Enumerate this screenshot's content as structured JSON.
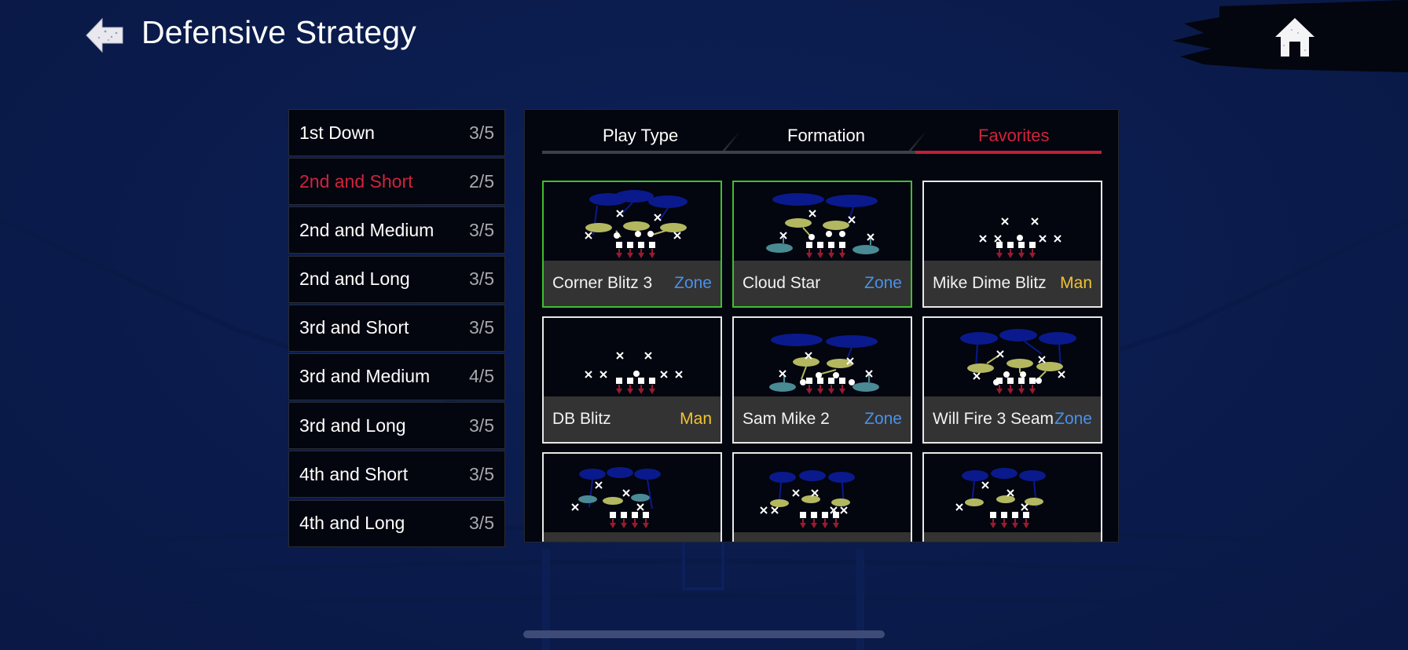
{
  "header": {
    "title": "Defensive Strategy",
    "back_icon": "back-arrow-icon",
    "home_icon": "home-icon"
  },
  "downs": [
    {
      "label": "1st Down",
      "count": "3/5",
      "active": false
    },
    {
      "label": "2nd and Short",
      "count": "2/5",
      "active": true
    },
    {
      "label": "2nd and Medium",
      "count": "3/5",
      "active": false
    },
    {
      "label": "2nd and Long",
      "count": "3/5",
      "active": false
    },
    {
      "label": "3rd and Short",
      "count": "3/5",
      "active": false
    },
    {
      "label": "3rd and Medium",
      "count": "4/5",
      "active": false
    },
    {
      "label": "3rd and Long",
      "count": "3/5",
      "active": false
    },
    {
      "label": "4th and Short",
      "count": "3/5",
      "active": false
    },
    {
      "label": "4th and Long",
      "count": "3/5",
      "active": false
    }
  ],
  "tabs": [
    {
      "label": "Play Type",
      "active": false
    },
    {
      "label": "Formation",
      "active": false
    },
    {
      "label": "Favorites",
      "active": true
    }
  ],
  "colors": {
    "accent_red": "#d0243b",
    "zone_blue": "#4a90e8",
    "man_yellow": "#f2c230",
    "selected_green": "#3fbf2e",
    "deep_zone": "#0a1a8c",
    "hook_zone": "#b3b860",
    "flat_zone": "#4a8a94",
    "blitz_arrow": "#9b1a2e"
  },
  "plays": [
    {
      "name": "Corner Blitz 3",
      "coverage": "Zone",
      "selected": true
    },
    {
      "name": "Cloud Star",
      "coverage": "Zone",
      "selected": true
    },
    {
      "name": "Mike Dime Blitz",
      "coverage": "Man",
      "selected": false
    },
    {
      "name": "DB Blitz",
      "coverage": "Man",
      "selected": false
    },
    {
      "name": "Sam Mike 2",
      "coverage": "Zone",
      "selected": false
    },
    {
      "name": "Will Fire 3 Seam",
      "coverage": "Zone",
      "selected": false
    },
    {
      "name": "",
      "coverage": "",
      "selected": false
    },
    {
      "name": "",
      "coverage": "",
      "selected": false
    },
    {
      "name": "",
      "coverage": "",
      "selected": false
    }
  ]
}
